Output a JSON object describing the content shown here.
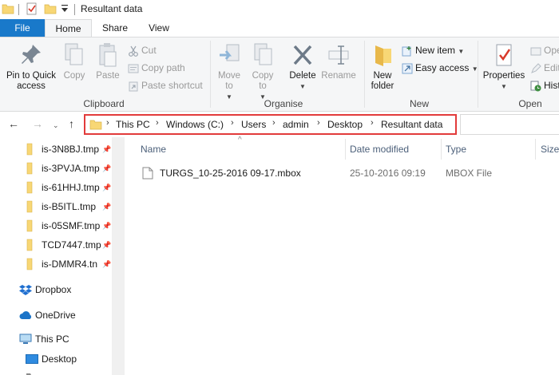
{
  "window": {
    "title": "Resultant data"
  },
  "tabs": {
    "file": "File",
    "home": "Home",
    "share": "Share",
    "view": "View"
  },
  "ribbon": {
    "clipboard": {
      "pin": "Pin to Quick\naccess",
      "copy": "Copy",
      "paste": "Paste",
      "cut": "Cut",
      "copy_path": "Copy path",
      "paste_shortcut": "Paste shortcut",
      "label": "Clipboard"
    },
    "organise": {
      "move_to": "Move\nto",
      "copy_to": "Copy\nto",
      "delete": "Delete",
      "rename": "Rename",
      "label": "Organise"
    },
    "new": {
      "new_folder": "New\nfolder",
      "new_item": "New item",
      "easy_access": "Easy access",
      "label": "New"
    },
    "open": {
      "properties": "Properties",
      "open": "Ope",
      "edit": "Edit",
      "history": "Hist",
      "label": "Open"
    }
  },
  "address": {
    "crumbs": [
      "This PC",
      "Windows (C:)",
      "Users",
      "admin",
      "Desktop",
      "Resultant data"
    ]
  },
  "nav": {
    "quick_access": [
      {
        "label": "is-3N8BJ.tmp"
      },
      {
        "label": "is-3PVJA.tmp"
      },
      {
        "label": "is-61HHJ.tmp"
      },
      {
        "label": "is-B5ITL.tmp"
      },
      {
        "label": "is-05SMF.tmp"
      },
      {
        "label": "TCD7447.tmp"
      },
      {
        "label": "is-DMMR4.tn"
      }
    ],
    "dropbox": "Dropbox",
    "onedrive": "OneDrive",
    "this_pc": "This PC",
    "desktop": "Desktop"
  },
  "columns": {
    "name": "Name",
    "date": "Date modified",
    "type": "Type",
    "size": "Size"
  },
  "files": [
    {
      "name": "TURGS_10-25-2016 09-17.mbox",
      "date": "25-10-2016 09:19",
      "type": "MBOX File"
    }
  ],
  "colors": {
    "accent": "#1979ca",
    "highlight": "#e23b3b",
    "folder": "#f8d775"
  }
}
